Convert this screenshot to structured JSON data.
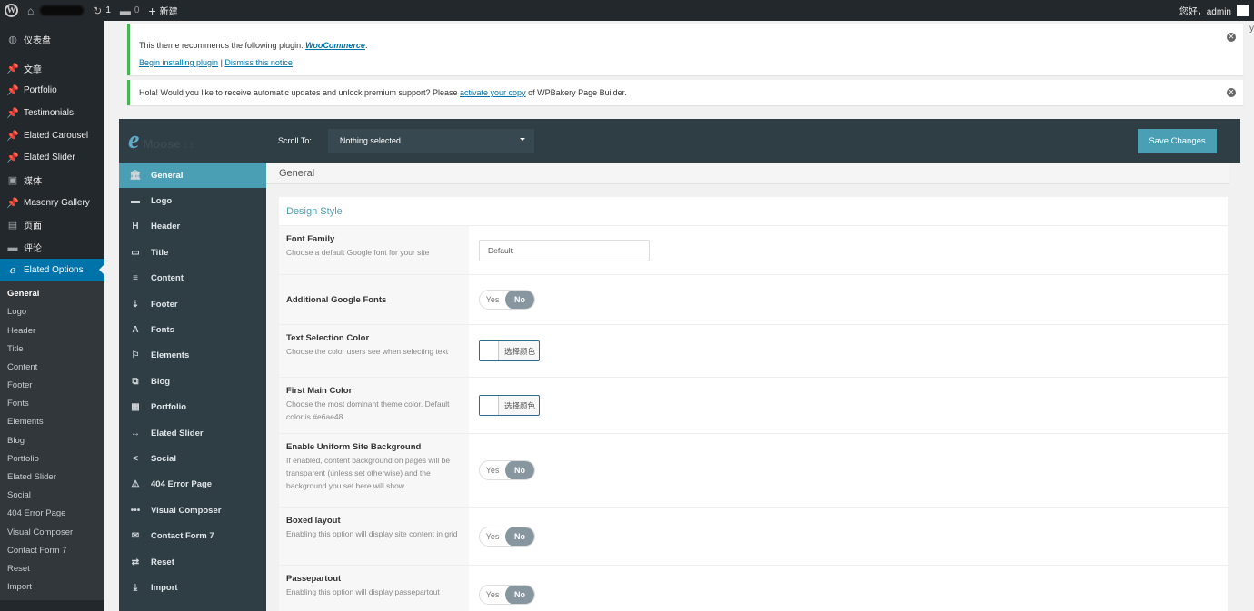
{
  "admin_bar": {
    "comment_count": "0",
    "updates_count": "1",
    "new_label": "新建",
    "greeting": "您好，admin"
  },
  "admin_menu": {
    "items": [
      {
        "icon": "dashboard-icon",
        "glyph": "◍",
        "label": "仪表盘"
      },
      {
        "icon": "pin-icon",
        "glyph": "📌",
        "label": "文章"
      },
      {
        "icon": "pin-icon",
        "glyph": "📌",
        "label": "Portfolio"
      },
      {
        "icon": "pin-icon",
        "glyph": "📌",
        "label": "Testimonials"
      },
      {
        "icon": "pin-icon",
        "glyph": "📌",
        "label": "Elated Carousel"
      },
      {
        "icon": "pin-icon",
        "glyph": "📌",
        "label": "Elated Slider"
      },
      {
        "icon": "media-icon",
        "glyph": "▣",
        "label": "媒体"
      },
      {
        "icon": "pin-icon",
        "glyph": "📌",
        "label": "Masonry Gallery"
      },
      {
        "icon": "page-icon",
        "glyph": "▤",
        "label": "页面"
      },
      {
        "icon": "comment-icon",
        "glyph": "▬",
        "label": "评论"
      },
      {
        "icon": "elated-icon",
        "glyph": "ℯ",
        "label": "Elated Options"
      }
    ],
    "sub_items": [
      "General",
      "Logo",
      "Header",
      "Title",
      "Content",
      "Footer",
      "Fonts",
      "Elements",
      "Blog",
      "Portfolio",
      "Elated Slider",
      "Social",
      "404 Error Page",
      "Visual Composer",
      "Contact Form 7",
      "Reset",
      "Import"
    ]
  },
  "notices": {
    "plugin": {
      "text_before": "This theme recommends the following plugin: ",
      "plugin_name": "WooCommerce",
      "text_after": ".",
      "begin_link": "Begin installing plugin",
      "separator": " | ",
      "dismiss_link": "Dismiss this notice"
    },
    "wpbakery": {
      "text_before": "Hola! Would you like to receive automatic updates and unlock premium support? Please ",
      "link": "activate your copy",
      "text_after": " of WPBakery Page Builder."
    },
    "corner_char": "y"
  },
  "options_panel": {
    "logo_mark": "e",
    "theme_name": "Moose",
    "version": "1.3",
    "scroll_to_label": "Scroll To:",
    "scroll_select_value": "Nothing selected",
    "save_label": "Save Changes",
    "nav": [
      {
        "label": "General",
        "icon": "bank-icon",
        "glyph": "🏛"
      },
      {
        "label": "Logo",
        "icon": "logo-icon",
        "glyph": "▬"
      },
      {
        "label": "Header",
        "icon": "header-icon",
        "glyph": "H"
      },
      {
        "label": "Title",
        "icon": "title-icon",
        "glyph": "▭"
      },
      {
        "label": "Content",
        "icon": "content-icon",
        "glyph": "≡"
      },
      {
        "label": "Footer",
        "icon": "footer-icon",
        "glyph": "⇣"
      },
      {
        "label": "Fonts",
        "icon": "fonts-icon",
        "glyph": "A"
      },
      {
        "label": "Elements",
        "icon": "flag-icon",
        "glyph": "⚐"
      },
      {
        "label": "Blog",
        "icon": "blog-icon",
        "glyph": "⧉"
      },
      {
        "label": "Portfolio",
        "icon": "portfolio-icon",
        "glyph": "▦"
      },
      {
        "label": "Elated Slider",
        "icon": "slider-icon",
        "glyph": "↔"
      },
      {
        "label": "Social",
        "icon": "share-icon",
        "glyph": "<"
      },
      {
        "label": "404 Error Page",
        "icon": "warning-icon",
        "glyph": "⚠"
      },
      {
        "label": "Visual Composer",
        "icon": "dots-icon",
        "glyph": "•••"
      },
      {
        "label": "Contact Form 7",
        "icon": "mail-icon",
        "glyph": "✉"
      },
      {
        "label": "Reset",
        "icon": "reset-icon",
        "glyph": "⇄"
      },
      {
        "label": "Import",
        "icon": "import-icon",
        "glyph": "⤓"
      }
    ],
    "section_title": "General",
    "card_title": "Design Style",
    "toggle_yes": "Yes",
    "toggle_no": "No",
    "color_button_label": "选择颜色",
    "options": {
      "font_family": {
        "name": "Font Family",
        "desc": "Choose a default Google font for your site",
        "value": "Default"
      },
      "additional_fonts": {
        "name": "Additional Google Fonts",
        "value": "No"
      },
      "text_selection_color": {
        "name": "Text Selection Color",
        "desc": "Choose the color users see when selecting text"
      },
      "first_main_color": {
        "name": "First Main Color",
        "desc": "Choose the most dominant theme color. Default color is #e6ae48."
      },
      "uniform_background": {
        "name": "Enable Uniform Site Background",
        "desc": "If enabled, content background on pages will be transparent (unless set otherwise) and the background you set here will show",
        "value": "No"
      },
      "boxed_layout": {
        "name": "Boxed layout",
        "desc": "Enabling this option will display site content in grid",
        "value": "No"
      },
      "passepartout": {
        "name": "Passepartout",
        "desc": "Enabling this option will display passepartout",
        "value": "No"
      }
    }
  },
  "colors": {
    "admin_bar": "#23282d",
    "menu_active": "#0073aa",
    "accent": "#4a9fb5",
    "panel_dark": "#2f3d45",
    "notice_border": "#46b450"
  }
}
